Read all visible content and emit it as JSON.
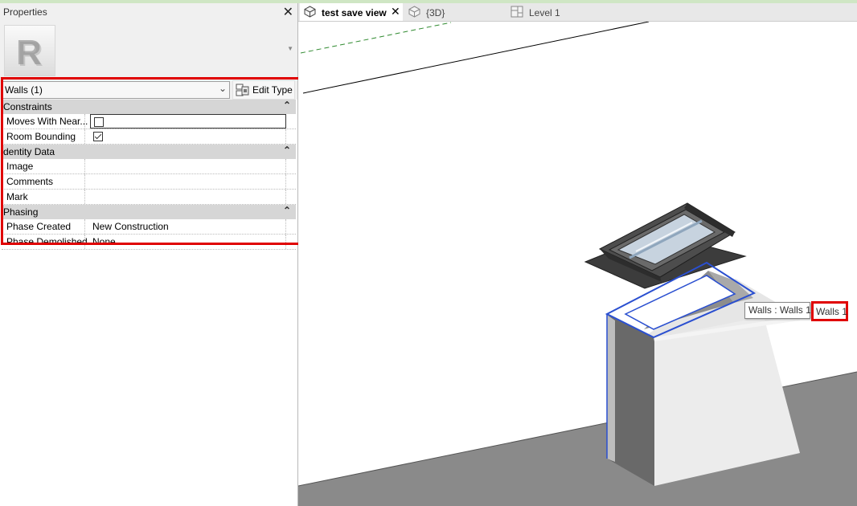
{
  "panel": {
    "title": "Properties",
    "close_glyph": "✕",
    "type_icon": "revit-r-logo-icon",
    "selector": {
      "value": "Walls (1)"
    },
    "edit_type_label": "Edit Type"
  },
  "groups": [
    {
      "label": "Constraints",
      "rows": [
        {
          "key": "Moves With Near...",
          "value": "",
          "checkbox": false
        },
        {
          "key": "Room Bounding",
          "value": "",
          "checkbox": true
        }
      ]
    },
    {
      "label": "dentity Data",
      "rows": [
        {
          "key": "Image",
          "value": ""
        },
        {
          "key": "Comments",
          "value": ""
        },
        {
          "key": "Mark",
          "value": ""
        }
      ]
    },
    {
      "label": "Phasing",
      "rows": [
        {
          "key": "Phase Created",
          "value": "New Construction"
        },
        {
          "key": "Phase Demolished",
          "value": "None"
        }
      ]
    }
  ],
  "collapse_glyph": "⌃",
  "tabs": [
    {
      "label": "test save view",
      "icon": "3d-view-icon",
      "active": true
    },
    {
      "label": "{3D}",
      "icon": "3d-view-icon",
      "active": false
    },
    {
      "label": "Level 1",
      "icon": "floor-plan-icon",
      "active": false
    }
  ],
  "tooltip": {
    "label": "Walls : Walls 1",
    "secondary": "Walls 1"
  },
  "colors": {
    "highlight": "#e00000",
    "selection": "#2a4fd0"
  }
}
